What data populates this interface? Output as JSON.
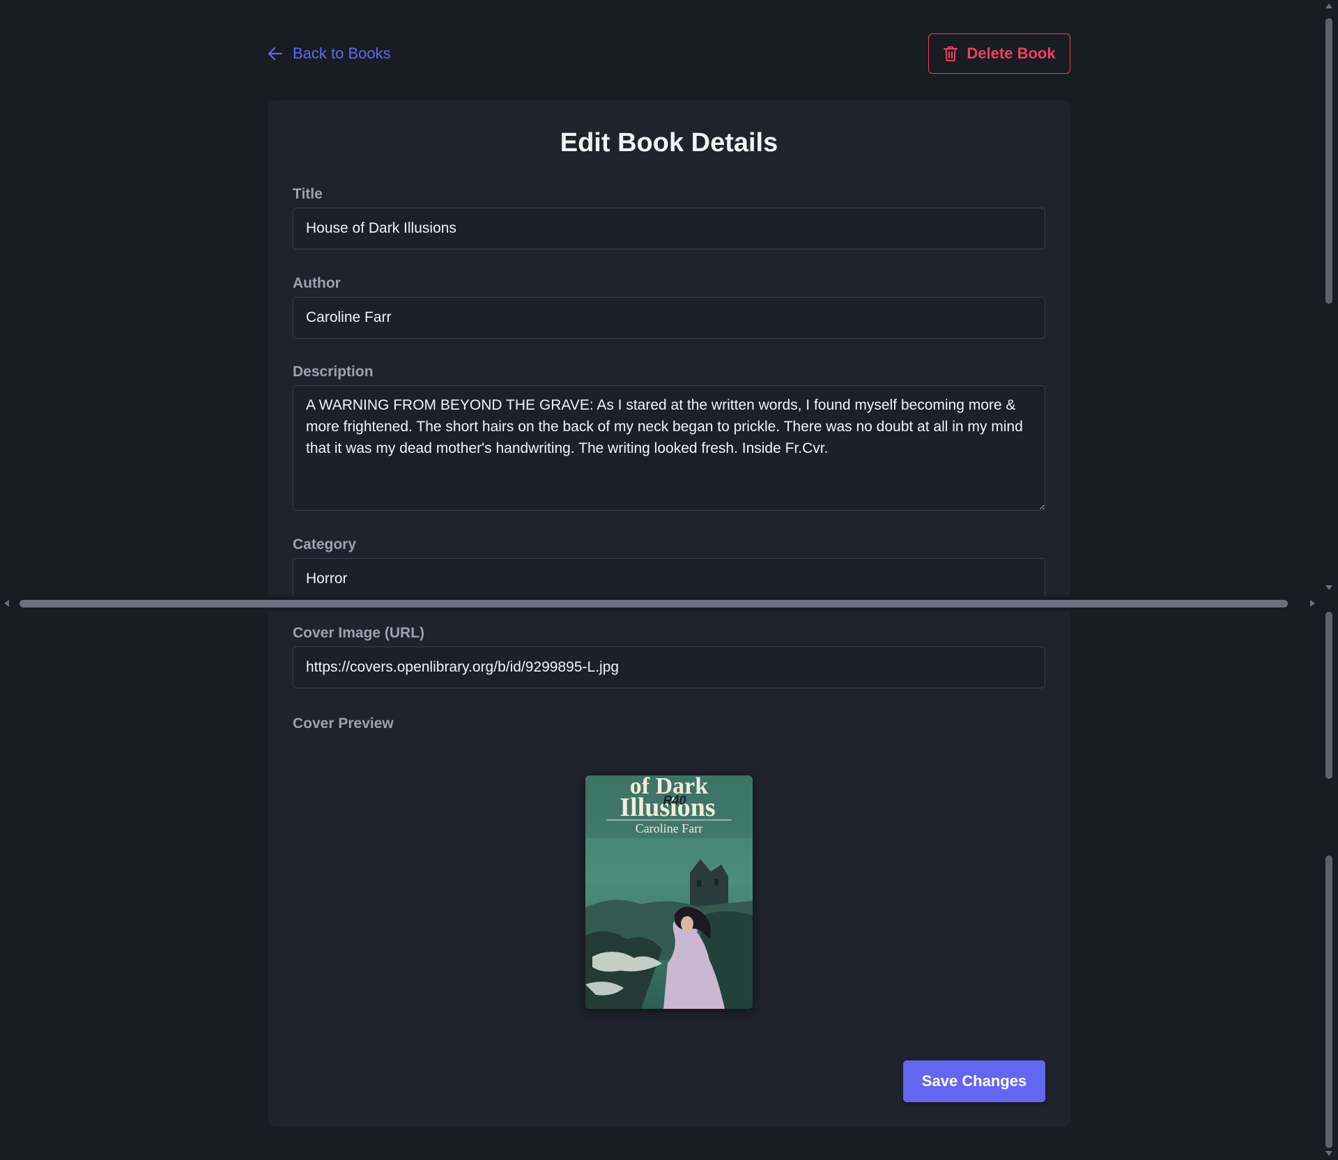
{
  "header": {
    "back_label": "Back to Books",
    "delete_label": "Delete Book"
  },
  "form": {
    "title": "Edit Book Details",
    "fields": {
      "title": {
        "label": "Title",
        "value": "House of Dark Illusions"
      },
      "author": {
        "label": "Author",
        "value": "Caroline Farr"
      },
      "description": {
        "label": "Description",
        "value": "A WARNING FROM BEYOND THE GRAVE: As I stared at the written words, I found myself becoming more & more frightened. The short hairs on the back of my neck began to prickle. There was no doubt at all in my mind that it was my dead mother's handwriting. The writing looked fresh. Inside Fr.Cvr."
      },
      "category": {
        "label": "Category",
        "value": "Horror"
      },
      "cover_url": {
        "label": "Cover Image (URL)",
        "value": "https://covers.openlibrary.org/b/id/9299895-L.jpg"
      }
    },
    "cover_preview_label": "Cover Preview",
    "cover_art": {
      "title_line1": "of Dark",
      "title_line2": "Illusions",
      "author": "Caroline Farr",
      "price_mark": "R40"
    },
    "save_label": "Save Changes"
  },
  "colors": {
    "accent": "#6366f1",
    "danger": "#f43f5e",
    "background": "#181c23",
    "card": "#1e232c"
  }
}
